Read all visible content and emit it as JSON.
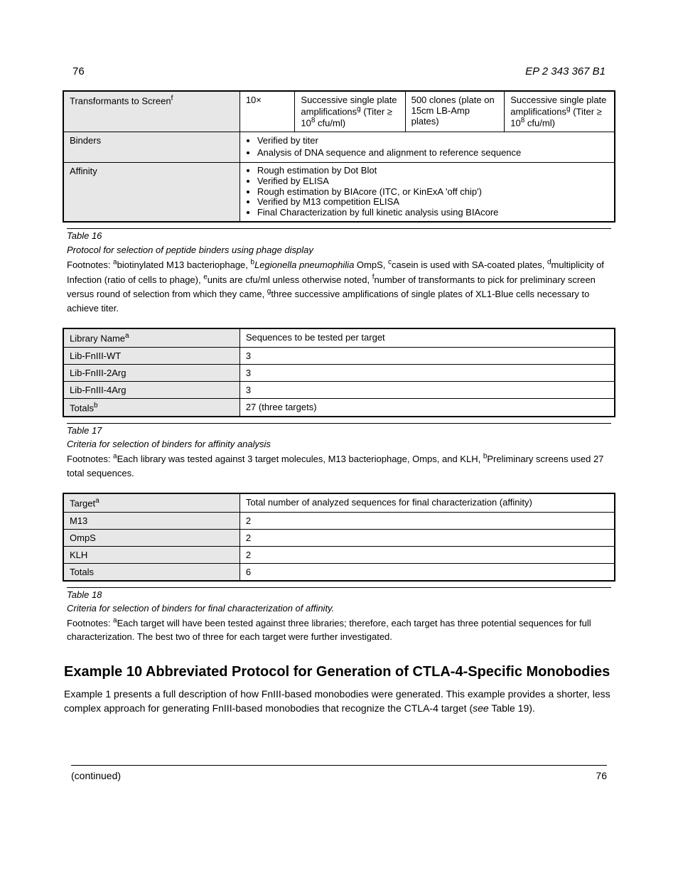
{
  "header": {
    "doc_code": "EP 2 343 367 B1",
    "page_label": "76"
  },
  "table1": {
    "rows": [
      {
        "label_html": "Transformants to Screen<span class='sup'>f</span>",
        "cells": [
          "10×",
          "Successive single plate amplifications<span class='sup'>g</span> (Titer ≥ 10<span class='sup'>8</span> cfu/ml)",
          "500 clones (plate on 15cm LB-Amp plates)",
          "Successive single plate amplifications<span class='sup'>g</span> (Titer ≥ 10<span class='sup'>8</span> cfu/ml)"
        ]
      },
      {
        "label": "Binders",
        "bullets": [
          "Verified by titer",
          "Analysis of DNA sequence and alignment to reference sequence"
        ]
      },
      {
        "label": "Affinity",
        "bullets": [
          "Rough estimation by Dot Blot",
          "Verified by ELISA",
          "Rough estimation by BIAcore (ITC, or KinExA 'off chip')",
          "Verified by M13 competition ELISA",
          "Final Characterization by full kinetic analysis using BIAcore"
        ]
      }
    ],
    "caption_label": "Table 16",
    "caption_title": "Protocol for selection of peptide binders using phage display",
    "footnotes": "Footnotes: <span class='sup'>a</span>biotinylated M13 bacteriophage, <span class='sup'>b</span><em>Legionella pneumophilia</em> OmpS, <span class='sup'>c</span>casein is used with SA-coated plates, <span class='sup'>d</span>multiplicity of Infection (ratio of cells to phage), <span class='sup'>e</span>units are cfu/ml unless otherwise noted, <span class='sup'>f</span>number of transformants to pick for preliminary screen versus round of selection from which they came, <span class='sup'>g</span>three successive amplifications of single plates of XL1-Blue cells necessary to achieve titer."
  },
  "table2": {
    "rows": [
      {
        "label_html": "Library Name<span class='sup'>a</span>",
        "value": "Sequences to be tested per target"
      },
      {
        "label": "Lib-FnIII-WT",
        "value": "3"
      },
      {
        "label": "Lib-FnIII-2Arg",
        "value": "3"
      },
      {
        "label": "Lib-FnIII-4Arg",
        "value": "3"
      },
      {
        "label_html": "Totals<span class='sup'>b</span>",
        "value": "27 (three targets)"
      }
    ],
    "caption_label": "Table 17",
    "caption_title": "Criteria for selection of binders for affinity analysis",
    "footnotes": "Footnotes: <span class='sup'>a</span>Each library was tested against 3 target molecules, M13 bacteriophage, Omps, and KLH, <span class='sup'>b</span>Preliminary screens used 27 total sequences."
  },
  "table3": {
    "rows": [
      {
        "label_html": "Target<span class='sup'>a</span>",
        "value": "Total number of analyzed sequences for final characterization (affinity)"
      },
      {
        "label": "M13",
        "value": "2"
      },
      {
        "label": "OmpS",
        "value": "2"
      },
      {
        "label": "KLH",
        "value": "2"
      },
      {
        "label": "Totals",
        "value": "6"
      }
    ],
    "caption_label": "Table 18",
    "caption_title": "Criteria for selection of binders for final characterization of affinity.",
    "footnotes": "Footnotes: <span class='sup'>a</span>Each target will have been tested against three libraries; therefore, each target has three potential sequences for full characterization. The best two of three for each target were further investigated."
  },
  "section": {
    "heading": "Example 10 Abbreviated Protocol for Generation of CTLA-4-Specific Monobodies",
    "para": "Example 1 presents a full description of how FnIII-based monobodies were generated. This example provides a shorter, less complex approach for generating FnIII-based monobodies that recognize the CTLA-4 target (<em>see</em> Table 19)."
  },
  "footer": {
    "left": "(continued)",
    "right": "76"
  }
}
